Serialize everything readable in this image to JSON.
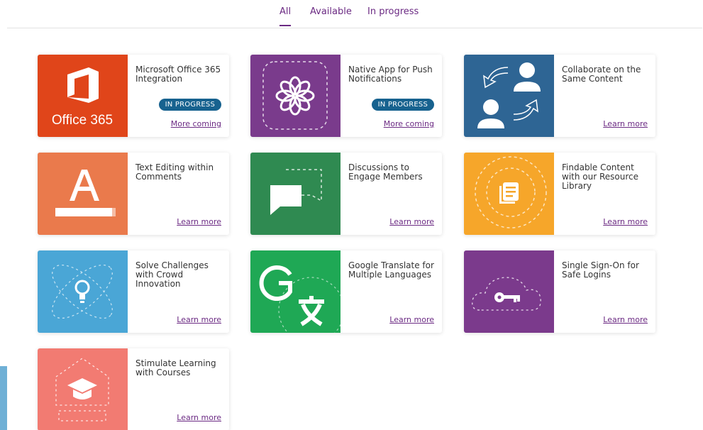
{
  "tabs": [
    {
      "label": "All"
    },
    {
      "label": "Available"
    },
    {
      "label": "In progress"
    }
  ],
  "cards": [
    {
      "title": "Microsoft Office 365 Integration",
      "badge": "IN PROGRESS",
      "link": "More coming",
      "color": "#e0451a",
      "thumb_text": "Office 365",
      "icon": "office365-icon"
    },
    {
      "title": "Native App for Push Notifications",
      "badge": "IN PROGRESS",
      "link": "More coming",
      "color": "#7a3b8c",
      "icon": "flower-icon"
    },
    {
      "title": "Collaborate on the Same Content",
      "link": "Learn more",
      "color": "#2e6594",
      "icon": "collaborate-icon"
    },
    {
      "title": "Text Editing within Comments",
      "link": "Learn more",
      "color": "#ea7a4c",
      "icon": "text-format-icon"
    },
    {
      "title": "Discussions to Engage Members",
      "link": "Learn more",
      "color": "#2f8a51",
      "icon": "chat-bubble-icon"
    },
    {
      "title": "Findable Content with our Resource Library",
      "link": "Learn more",
      "color": "#f6a62a",
      "icon": "library-icon"
    },
    {
      "title": "Solve Challenges with Crowd Innovation",
      "link": "Learn more",
      "color": "#4aa6d6",
      "icon": "lightbulb-icon"
    },
    {
      "title": "Google Translate for Multiple Languages",
      "link": "Learn more",
      "color": "#1fa855",
      "icon": "translate-icon"
    },
    {
      "title": "Single Sign-On for Safe Logins",
      "link": "Learn more",
      "color": "#7b3a8c",
      "icon": "key-cloud-icon"
    },
    {
      "title": "Stimulate Learning with Courses",
      "link": "Learn more",
      "color": "#f27b72",
      "icon": "graduation-cap-icon"
    }
  ],
  "accent": "#6b2a83",
  "badge_color": "#17628f"
}
